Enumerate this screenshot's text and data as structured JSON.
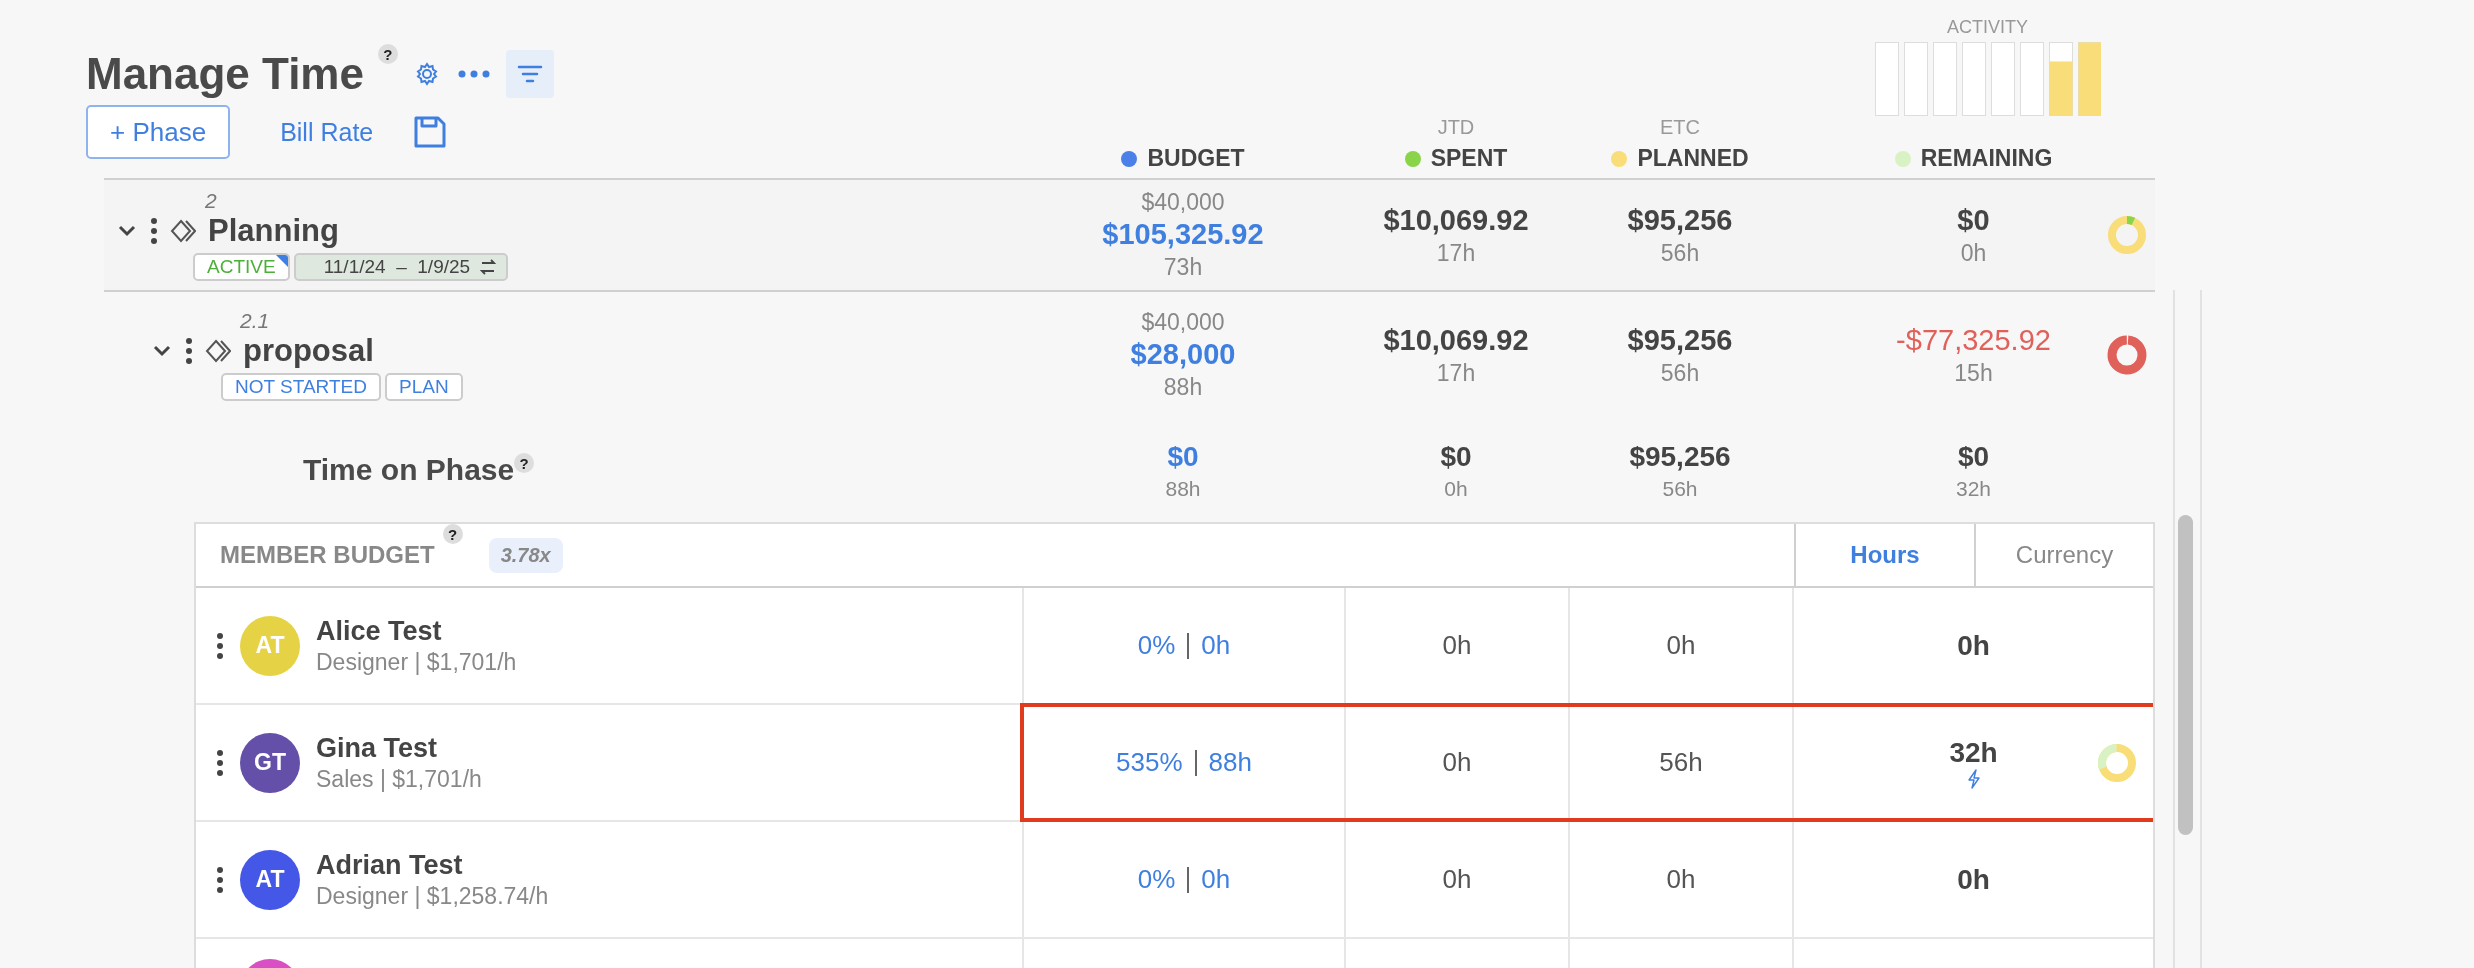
{
  "header": {
    "title": "Manage Time",
    "help": "?",
    "add_phase_button": "+ Phase",
    "bill_rate_link": "Bill Rate"
  },
  "activity": {
    "label": "ACTIVITY"
  },
  "columns": [
    {
      "label": "BUDGET",
      "color": "#4a80e8"
    },
    {
      "caption": "JTD",
      "label": "SPENT",
      "color": "#8ad44a"
    },
    {
      "caption": "ETC",
      "label": "PLANNED",
      "color": "#f9dd78"
    },
    {
      "label": "REMAINING",
      "color": "#d8f2c4"
    }
  ],
  "phases": [
    {
      "number": "2",
      "name": "Planning",
      "expanded": true,
      "tags": [
        {
          "kind": "status",
          "label": "ACTIVE",
          "color": "#4caf3a"
        },
        {
          "kind": "dates",
          "label": "11/1/24  –  1/9/25"
        }
      ],
      "budget": {
        "target": "$40,000",
        "amount": "$105,325.92",
        "hours": "73h"
      },
      "spent": {
        "amount": "$10,069.92",
        "hours": "17h"
      },
      "planned": {
        "amount": "$95,256",
        "hours": "56h"
      },
      "remaining": {
        "amount": "$0",
        "hours": "0h",
        "over_budget": false
      },
      "donut": {
        "kind": "planned"
      },
      "children": [
        {
          "number": "2.1",
          "name": "proposal",
          "expanded": true,
          "tags": [
            {
              "kind": "status",
              "label": "NOT STARTED",
              "color": "#3f7fe0"
            },
            {
              "kind": "status",
              "label": "PLAN",
              "color": "#3f7fe0"
            }
          ],
          "budget": {
            "target": "$40,000",
            "amount": "$28,000",
            "hours": "88h"
          },
          "spent": {
            "amount": "$10,069.92",
            "hours": "17h"
          },
          "planned": {
            "amount": "$95,256",
            "hours": "56h"
          },
          "remaining": {
            "amount": "-$77,325.92",
            "hours": "15h",
            "over_budget": true
          },
          "donut": {
            "kind": "overbudget"
          }
        }
      ]
    }
  ],
  "time_on_phase": {
    "label": "Time on Phase",
    "help": "?",
    "budget": {
      "amount": "$0",
      "hours": "88h"
    },
    "spent": {
      "amount": "$0",
      "hours": "0h"
    },
    "planned": {
      "amount": "$95,256",
      "hours": "56h"
    },
    "remaining": {
      "amount": "$0",
      "hours": "32h"
    }
  },
  "member_budget": {
    "title": "MEMBER BUDGET",
    "help": "?",
    "multiplier": "3.78x",
    "units": [
      {
        "label": "Hours",
        "selected": true
      },
      {
        "label": "Currency",
        "selected": false
      }
    ],
    "members": [
      {
        "name": "Alice Test",
        "subtitle": "Designer | $1,701/h",
        "initials": "AT",
        "color": "#e6d345",
        "budget_percent": "0%",
        "budget_hours": "0h",
        "spent": "0h",
        "planned": "0h",
        "remaining": "0h",
        "highlighted": false,
        "alert": false
      },
      {
        "name": "Gina Test",
        "subtitle": "Sales | $1,701/h",
        "initials": "GT",
        "color": "#6450a8",
        "budget_percent": "535%",
        "budget_hours": "88h",
        "spent": "0h",
        "planned": "56h",
        "remaining": "32h",
        "highlighted": true,
        "alert": true,
        "donut": {
          "kind": "split"
        }
      },
      {
        "name": "Adrian Test",
        "subtitle": "Designer | $1,258.74/h",
        "initials": "AT",
        "color": "#4457e6",
        "budget_percent": "0%",
        "budget_hours": "0h",
        "spent": "0h",
        "planned": "0h",
        "remaining": "0h",
        "highlighted": false,
        "alert": false
      },
      {
        "color": "#d94fc4"
      }
    ]
  }
}
